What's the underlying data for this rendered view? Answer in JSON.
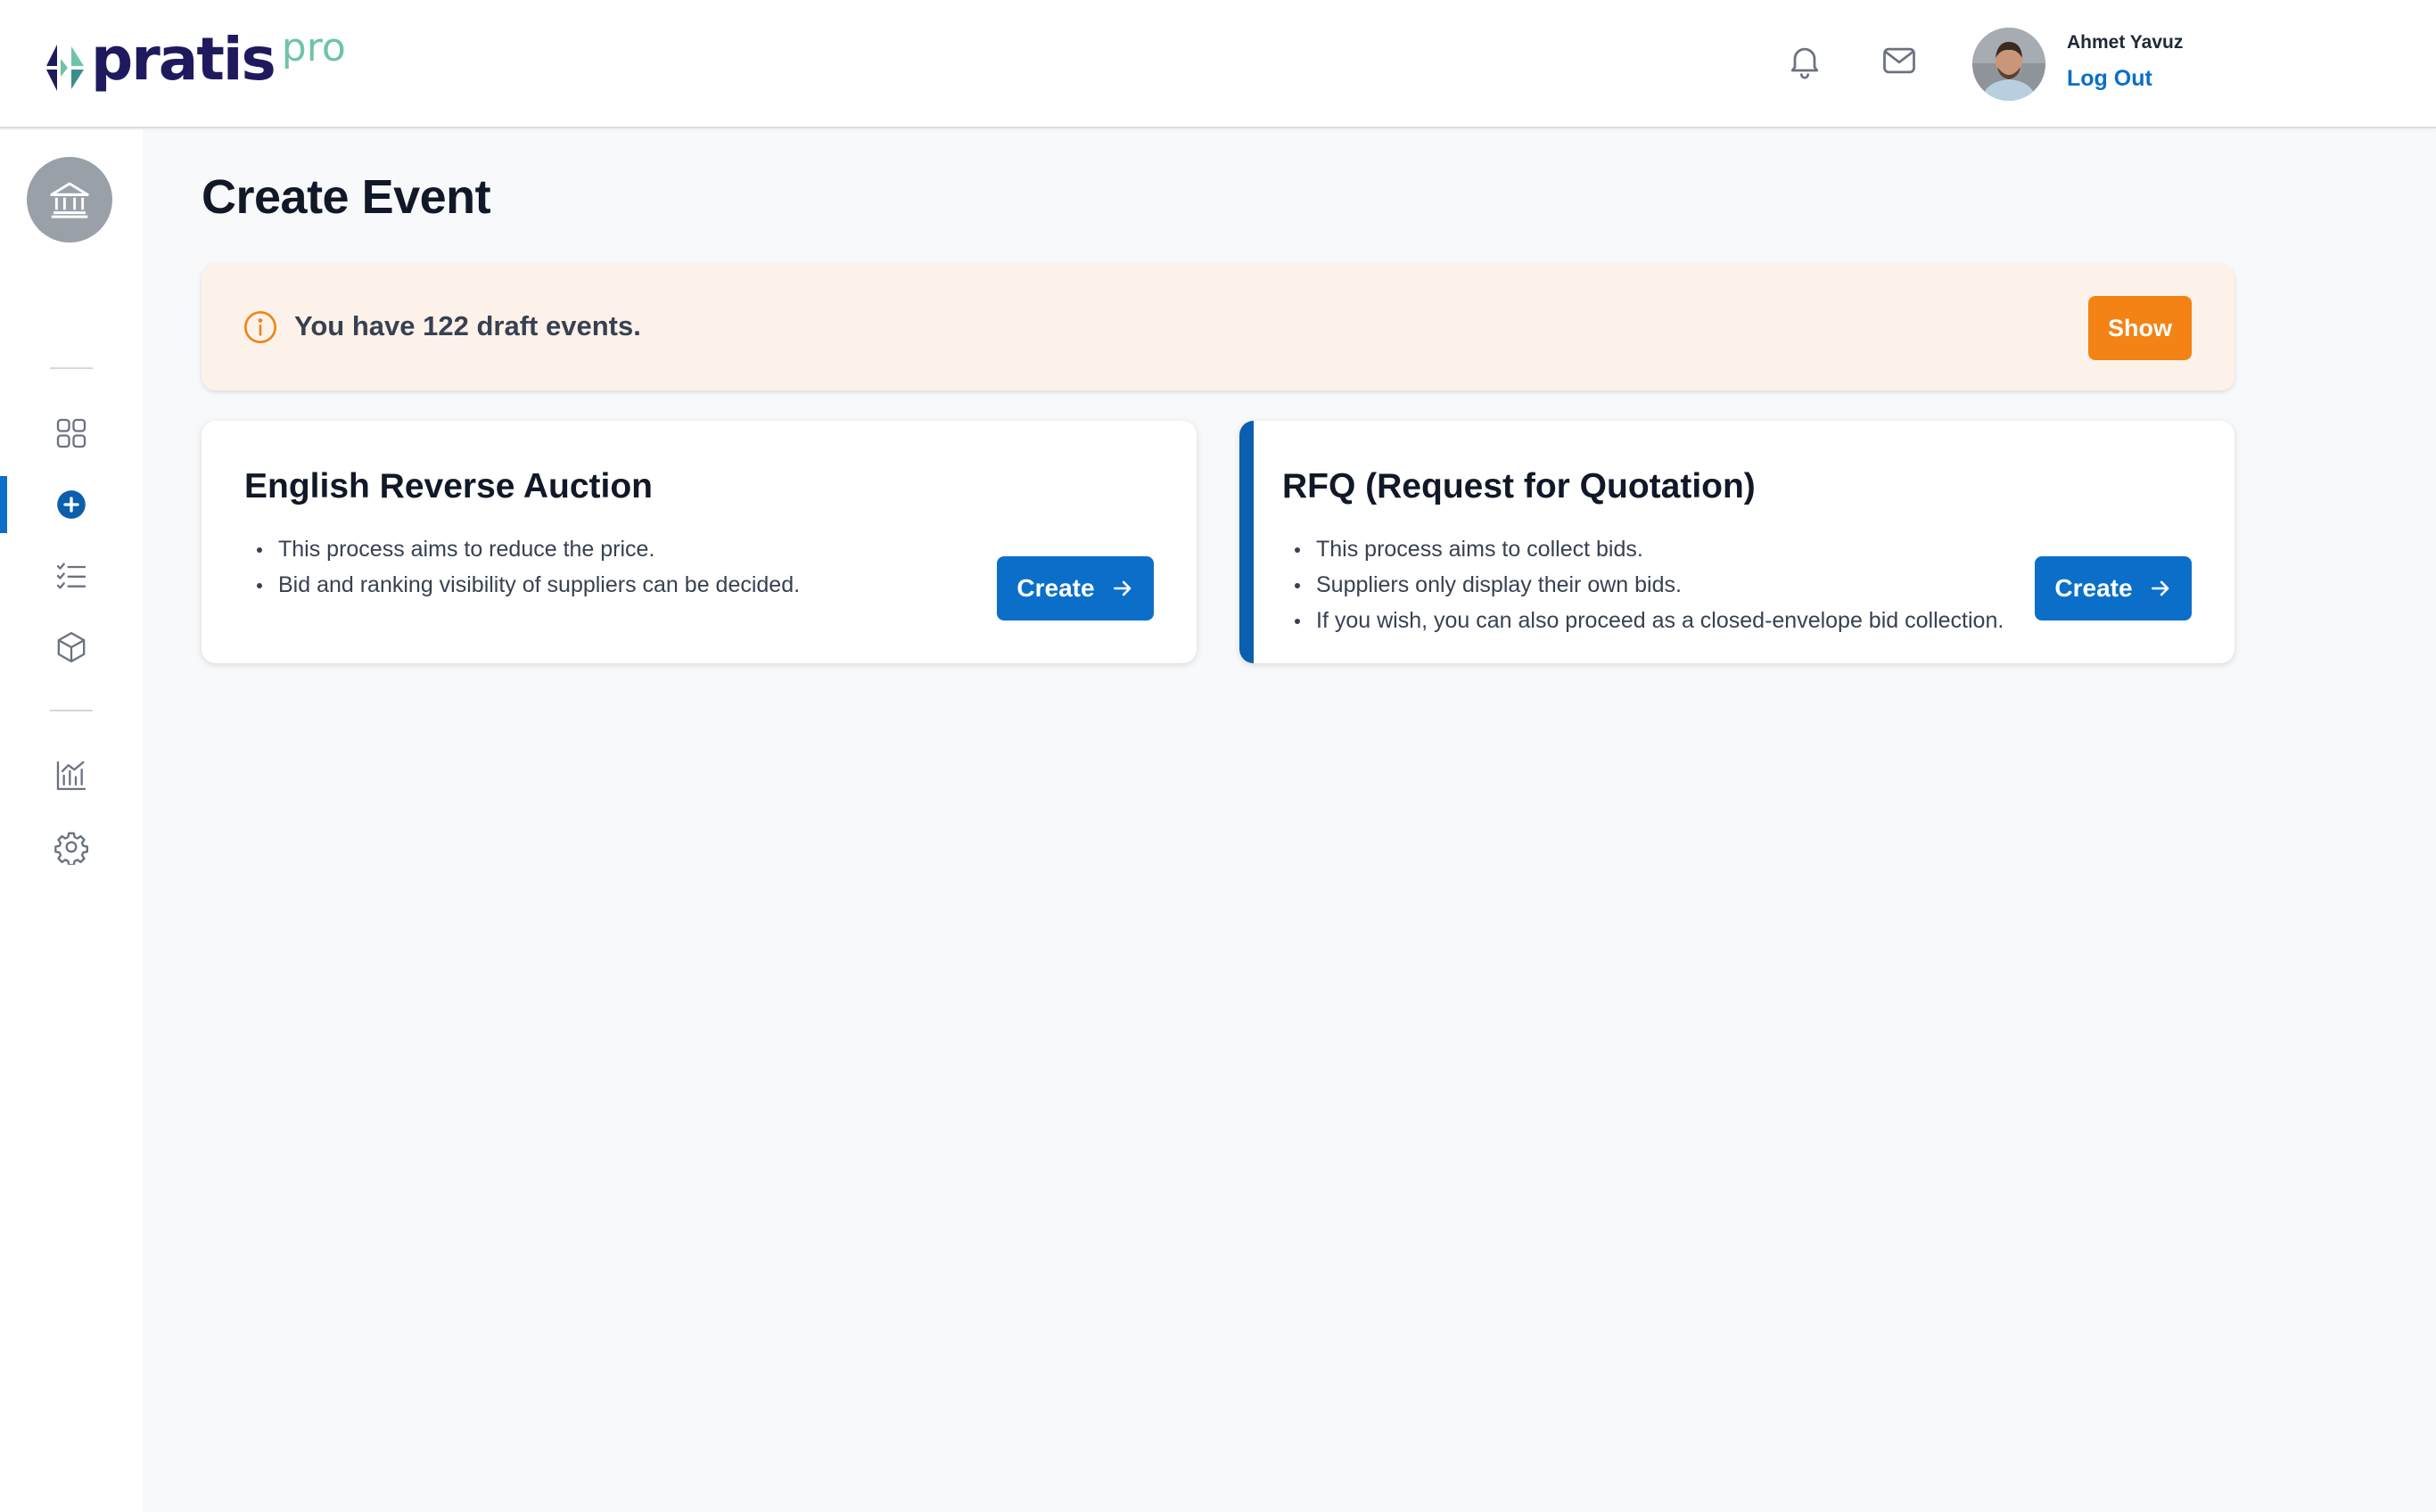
{
  "header": {
    "logo_word": "pratis",
    "logo_sub": "pro",
    "user_name": "Ahmet Yavuz",
    "logout_label": "Log Out",
    "icons": [
      "bell-icon",
      "mail-icon"
    ]
  },
  "sidebar": {
    "org_icon": "bank-icon",
    "items": [
      {
        "icon": "dashboard-grid-icon",
        "active": false
      },
      {
        "icon": "plus-circle-icon",
        "active": true
      },
      {
        "icon": "checklist-icon",
        "active": false
      },
      {
        "icon": "box-icon",
        "active": false
      },
      {
        "icon": "chart-icon",
        "active": false
      },
      {
        "icon": "gear-icon",
        "active": false
      }
    ]
  },
  "main": {
    "title": "Create Event",
    "draft_banner": {
      "text": "You have 122 draft events.",
      "button": "Show"
    },
    "cards": [
      {
        "title": "English Reverse Auction",
        "bullets": [
          "This process aims to reduce the price.",
          "Bid and ranking visibility of suppliers can be decided."
        ],
        "button": "Create"
      },
      {
        "title": "RFQ (Request for Quotation)",
        "bullets": [
          "This process aims to collect bids.",
          "Suppliers only display their own bids.",
          "If you wish, you can also proceed as a closed-envelope bid collection."
        ],
        "button": "Create"
      }
    ]
  },
  "colors": {
    "brand_navy": "#1f1a5e",
    "brand_green": "#6fc3a7",
    "primary_blue": "#0b6fc9",
    "warning_orange": "#f28314",
    "banner_bg": "#fdf2ea"
  }
}
